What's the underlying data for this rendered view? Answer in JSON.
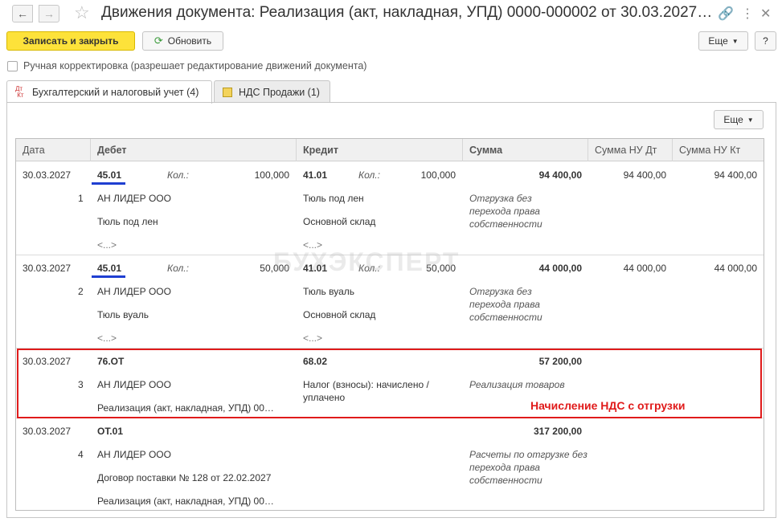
{
  "window": {
    "title": "Движения документа: Реализация (акт, накладная, УПД) 0000-000002 от 30.03.2027…"
  },
  "toolbar": {
    "save_close_label": "Записать и закрыть",
    "refresh_label": "Обновить",
    "more_label": "Еще",
    "help_label": "?"
  },
  "manual_adjust": {
    "label": "Ручная корректировка (разрешает редактирование движений документа)"
  },
  "tabs": [
    {
      "icon_text": "Дт\nКт",
      "label": "Бухгалтерский и налоговый учет (4)"
    },
    {
      "label": "НДС Продажи (1)"
    }
  ],
  "panel": {
    "more_label": "Еще"
  },
  "grid": {
    "columns": [
      "Дата",
      "Дебет",
      "Кредит",
      "Сумма",
      "Сумма НУ Дт",
      "Сумма НУ Кт"
    ],
    "qty_label": "Кол.:",
    "rows": [
      {
        "date": "30.03.2027",
        "num": "1",
        "debit_account": "45.01",
        "debit_qty": "100,000",
        "debit_sub1": "АН ЛИДЕР ООО",
        "debit_sub2": "Тюль под лен",
        "debit_sub3": "<...>",
        "credit_account": "41.01",
        "credit_qty": "100,000",
        "credit_sub1": "Тюль под лен",
        "credit_sub2": "Основной склад",
        "credit_sub3": "<...>",
        "sum": "94 400,00",
        "sum_note": "Отгрузка без перехода права собственности",
        "nu_dt": "94 400,00",
        "nu_kt": "94 400,00"
      },
      {
        "date": "30.03.2027",
        "num": "2",
        "debit_account": "45.01",
        "debit_qty": "50,000",
        "debit_sub1": "АН ЛИДЕР ООО",
        "debit_sub2": "Тюль вуаль",
        "debit_sub3": "<...>",
        "credit_account": "41.01",
        "credit_qty": "50,000",
        "credit_sub1": "Тюль вуаль",
        "credit_sub2": "Основной склад",
        "credit_sub3": "<...>",
        "sum": "44 000,00",
        "sum_note": "Отгрузка без перехода права собственности",
        "nu_dt": "44 000,00",
        "nu_kt": "44 000,00"
      },
      {
        "date": "30.03.2027",
        "num": "3",
        "debit_account": "76.ОТ",
        "debit_sub1": "АН ЛИДЕР ООО",
        "debit_sub2": "Реализация (акт, накладная, УПД) 00…",
        "credit_account": "68.02",
        "credit_sub1": "Налог (взносы): начислено / уплачено",
        "sum": "57 200,00",
        "sum_note": "Реализация товаров"
      },
      {
        "date": "30.03.2027",
        "num": "4",
        "debit_account": "ОТ.01",
        "debit_sub1": "АН ЛИДЕР ООО",
        "debit_sub2": "Договор поставки № 128 от 22.02.2027",
        "debit_sub3": "Реализация (акт, накладная, УПД) 00…",
        "sum": "317 200,00",
        "sum_note": "Расчеты по отгрузке без перехода права собственности"
      }
    ]
  },
  "annotation": {
    "text": "Начисление НДС с отгрузки"
  },
  "watermark": {
    "text": "БУХЭКСПЕРТ"
  },
  "colors": {
    "primary_button": "#fde23a",
    "highlight": "#e01b1b",
    "underline": "#1f3fd1"
  }
}
